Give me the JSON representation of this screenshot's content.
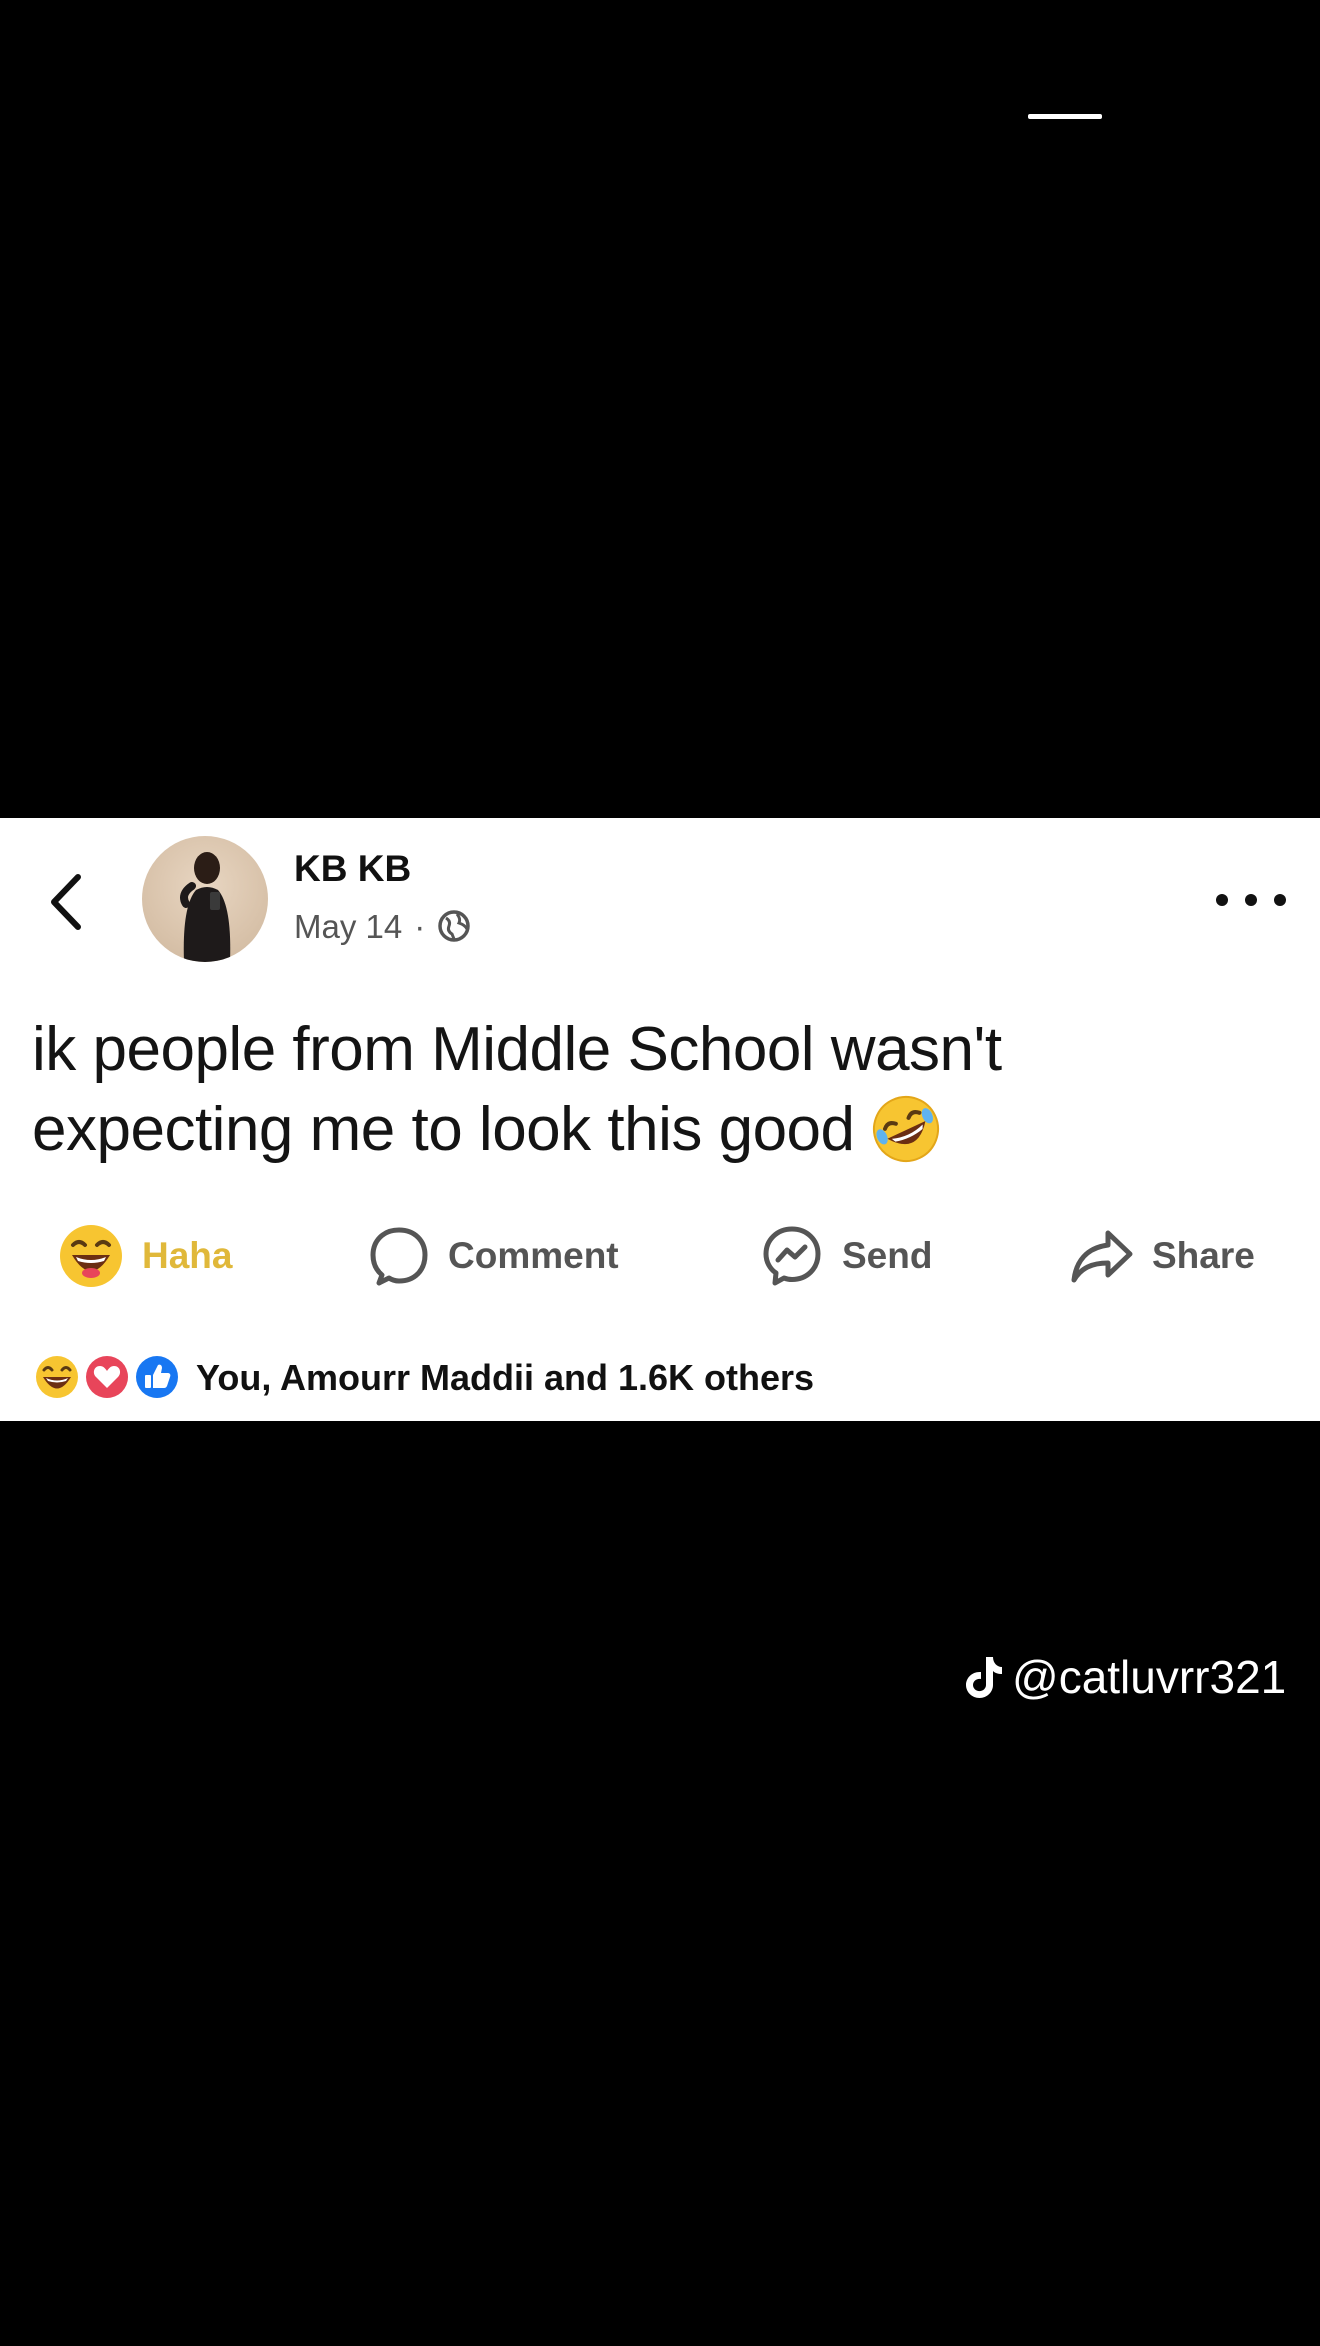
{
  "post": {
    "author": "KB KB",
    "date": "May 14",
    "separator": "·",
    "text": "ik people from Middle School wasn't expecting me to look this good",
    "emoji": "rolling-on-floor-laughing",
    "audience_icon": "globe-icon"
  },
  "actions": {
    "haha": "Haha",
    "comment": "Comment",
    "send": "Send",
    "share": "Share"
  },
  "reactions": {
    "summary": "You, Amourr Maddii and 1.6K others",
    "icons": [
      "haha-icon",
      "love-icon",
      "like-icon"
    ]
  },
  "watermark": {
    "handle": "@catluvrr321",
    "icon": "tiktok-icon"
  },
  "colors": {
    "haha_yellow": "#e0b83a",
    "love_red": "#e8455a",
    "like_blue": "#1877f2"
  }
}
